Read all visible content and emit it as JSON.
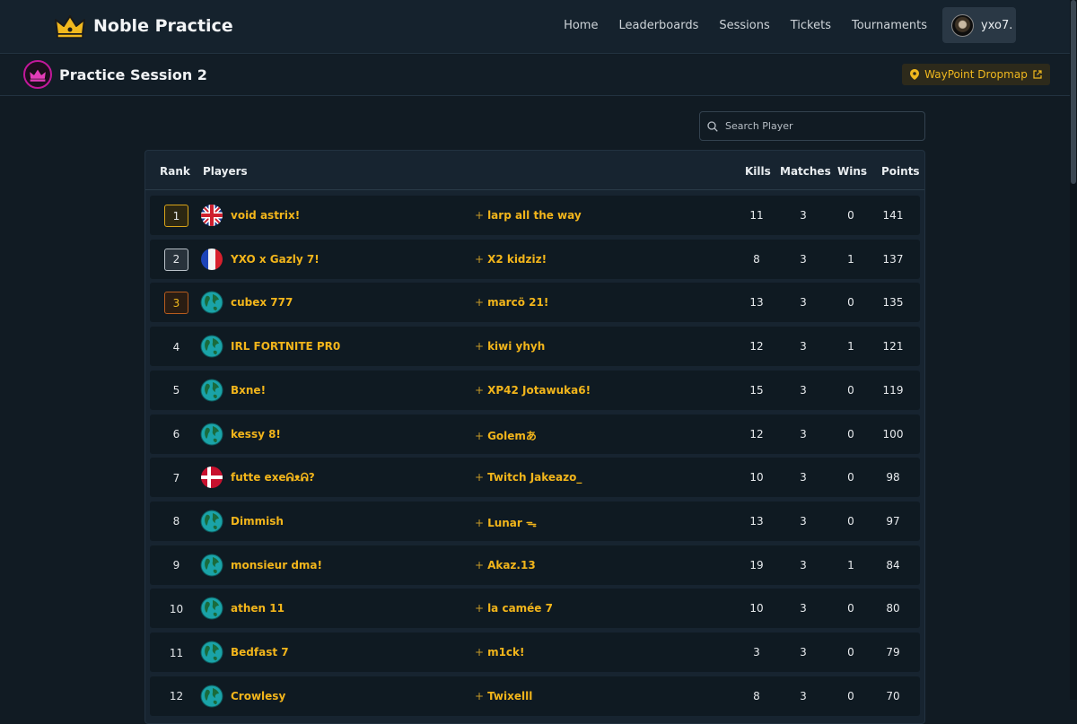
{
  "app": {
    "brand": "Noble Practice",
    "nav": [
      "Home",
      "Leaderboards",
      "Sessions",
      "Tickets",
      "Tournaments"
    ],
    "user": "yxo7."
  },
  "session": {
    "title": "Practice Session 2",
    "dropmap_label": "WayPoint Dropmap"
  },
  "search": {
    "placeholder": "Search Player"
  },
  "table": {
    "headers": {
      "rank": "Rank",
      "players": "Players",
      "kills": "Kills",
      "matches": "Matches",
      "wins": "Wins",
      "points": "Points"
    },
    "rows": [
      {
        "rank": "1",
        "flag": "uk-flag",
        "player1": "void astrix!",
        "player2": "larp all the way",
        "kills": "11",
        "matches": "3",
        "wins": "0",
        "points": "141"
      },
      {
        "rank": "2",
        "flag": "france-flag",
        "player1": "YXO x Gazly 7!",
        "player2": "X2 kidziz!",
        "kills": "8",
        "matches": "3",
        "wins": "1",
        "points": "137"
      },
      {
        "rank": "3",
        "flag": "globe",
        "player1": "cubex 777",
        "player2": "marcö 21!",
        "kills": "13",
        "matches": "3",
        "wins": "0",
        "points": "135"
      },
      {
        "rank": "4",
        "flag": "globe",
        "player1": "IRL FORTNITE PR0",
        "player2": "kiwi yhyh",
        "kills": "12",
        "matches": "3",
        "wins": "1",
        "points": "121"
      },
      {
        "rank": "5",
        "flag": "globe",
        "player1": "Bxne!",
        "player2": "XP42 Jotawuka6!",
        "kills": "15",
        "matches": "3",
        "wins": "0",
        "points": "119"
      },
      {
        "rank": "6",
        "flag": "globe",
        "player1": "kessy 8!",
        "player2": "Golemあ",
        "kills": "12",
        "matches": "3",
        "wins": "0",
        "points": "100"
      },
      {
        "rank": "7",
        "flag": "denmark-flag",
        "player1": "futte exeᕱᴥᕱ?",
        "player2": "Twitch Jakeazo_",
        "kills": "10",
        "matches": "3",
        "wins": "0",
        "points": "98"
      },
      {
        "rank": "8",
        "flag": "globe",
        "player1": "Dimmish",
        "player2": "Lunar ᯓ",
        "kills": "13",
        "matches": "3",
        "wins": "0",
        "points": "97"
      },
      {
        "rank": "9",
        "flag": "globe",
        "player1": "monsieur dma!",
        "player2": "Akaz.13",
        "kills": "19",
        "matches": "3",
        "wins": "1",
        "points": "84"
      },
      {
        "rank": "10",
        "flag": "globe",
        "player1": "athen 11",
        "player2": "la camée 7",
        "kills": "10",
        "matches": "3",
        "wins": "0",
        "points": "80"
      },
      {
        "rank": "11",
        "flag": "globe",
        "player1": "Bedfast 7",
        "player2": "m1ck!",
        "kills": "3",
        "matches": "3",
        "wins": "0",
        "points": "79"
      },
      {
        "rank": "12",
        "flag": "globe",
        "player1": "Crowlesy",
        "player2": "Twixelll",
        "kills": "8",
        "matches": "3",
        "wins": "0",
        "points": "70"
      }
    ]
  },
  "colors": {
    "accent": "#f2b51b",
    "background": "#111b23",
    "row": "#0f1a22",
    "session_ring": "#c2189a"
  }
}
